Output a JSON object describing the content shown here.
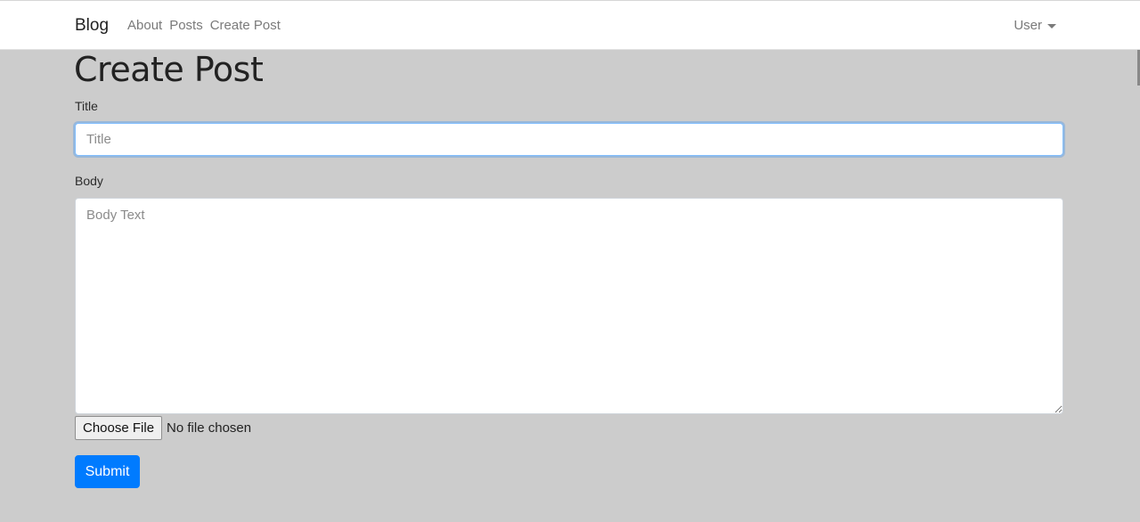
{
  "navbar": {
    "brand": "Blog",
    "links": [
      "About",
      "Posts",
      "Create Post"
    ],
    "user_menu": "User"
  },
  "page": {
    "title": "Create Post"
  },
  "form": {
    "title_label": "Title",
    "title_placeholder": "Title",
    "title_value": "",
    "body_label": "Body",
    "body_placeholder": "Body Text",
    "body_value": "",
    "file_button_label": "Choose File",
    "file_status": "No file chosen",
    "submit_label": "Submit"
  },
  "colors": {
    "background": "#cccccc",
    "navbar": "#ffffff",
    "primary": "#007bff"
  }
}
